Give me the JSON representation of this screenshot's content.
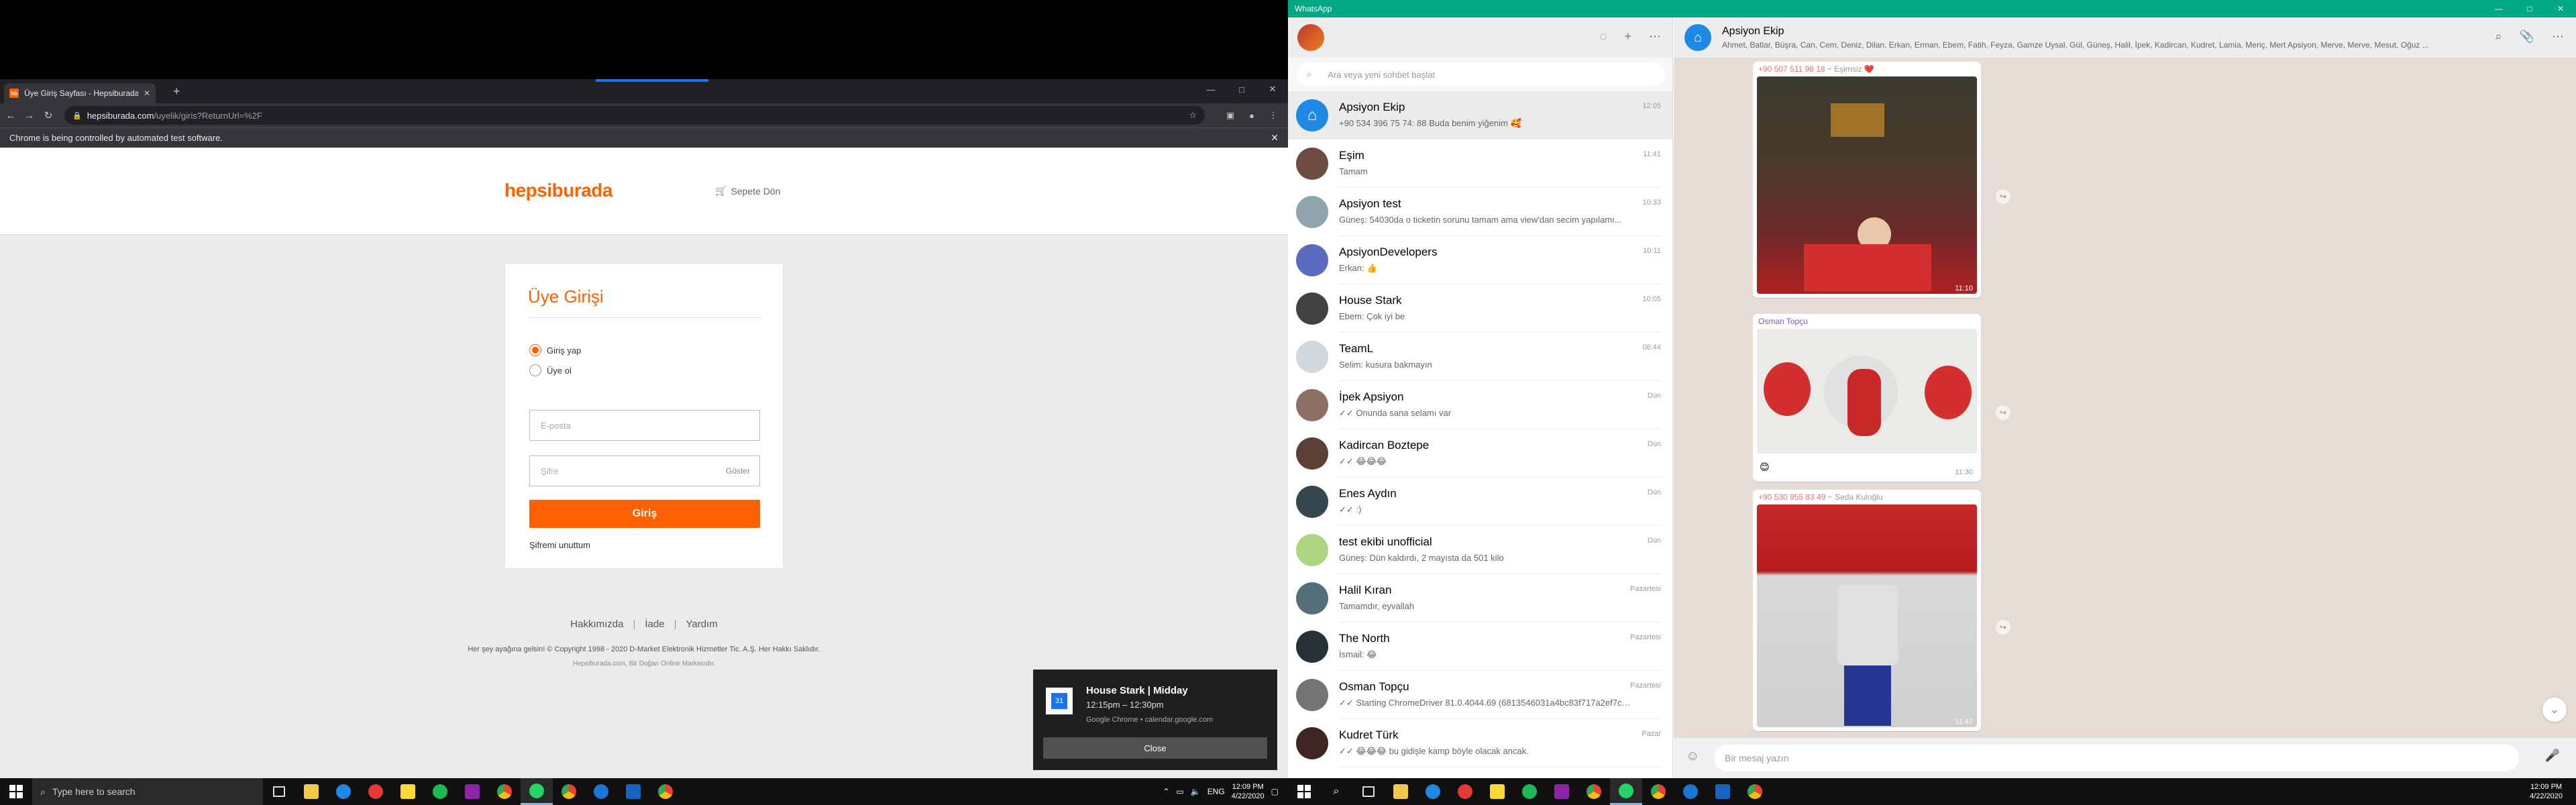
{
  "browser": {
    "tab_title": "Üye Giriş Sayfası - Hepsiburada...",
    "tab_favicon_text": "hb",
    "url_host": "hepsiburada.com",
    "url_path": "/uyelik/giris?ReturnUrl=%2F",
    "infobar_text": "Chrome is being controlled by automated test software.",
    "window_controls": [
      "—",
      "□",
      "✕"
    ]
  },
  "site": {
    "logo": "hepsiburada",
    "cart_link": "Sepete Dön",
    "login_title": "Üye Girişi",
    "radio_login": "Giriş yap",
    "radio_register": "Üye ol",
    "email_placeholder": "E-posta",
    "password_placeholder": "Şifre",
    "show_label": "Göster",
    "submit_label": "Giriş",
    "forgot_label": "Şifremi unuttum",
    "footer_links": [
      "Hakkımızda",
      "İade",
      "Yardım"
    ],
    "footer_sep": "|",
    "copyright": "Her şey ayağına gelsin! © Copyright 1998 - 2020 D-Market Elektronik Hizmetler Tic. A.Ş. Her Hakkı Saklıdır.",
    "copyright_sub": "Hepsiburada.com, Bir Doğan Online Markasıdır."
  },
  "toast": {
    "title": "House Stark | Midday",
    "time": "12:15pm – 12:30pm",
    "source": "Google Chrome • calendar.google.com",
    "close_label": "Close",
    "icon_text": "31"
  },
  "taskbar_left": {
    "search_placeholder": "Type here to search",
    "time": "12:09 PM",
    "date": "4/22/2020"
  },
  "taskbar_right": {
    "time": "12:09 PM",
    "date": "4/22/2020"
  },
  "whatsapp": {
    "app_title": "WhatsApp",
    "search_placeholder": "Ara veya yeni sohbet başlat",
    "chats": [
      {
        "name": "Apsiyon Ekip",
        "time": "12:05",
        "last": "+90 534 396 75 74: 88 Buda benim yiğenim 🥰"
      },
      {
        "name": "Eşim",
        "time": "11:41",
        "last": "Tamam"
      },
      {
        "name": "Apsiyon test",
        "time": "10:33",
        "last": "Güneş: 54030da o ticketin sorunu tamam ama view'dan secim yapılamı..."
      },
      {
        "name": "ApsiyonDevelopers",
        "time": "10:11",
        "last": "Erkan: 👍"
      },
      {
        "name": "House Stark",
        "time": "10:05",
        "last": "Ebem: Çok iyi be"
      },
      {
        "name": "TeamL",
        "time": "08:44",
        "last": "Selim: kusura bakmayın"
      },
      {
        "name": "İpek Apsiyon",
        "time": "Dün",
        "last": "✓✓ Onunda sana selamı var"
      },
      {
        "name": "Kadircan Boztepe",
        "time": "Dün",
        "last": "✓✓ 😂😂😂"
      },
      {
        "name": "Enes Aydın",
        "time": "Dün",
        "last": "✓✓ :)"
      },
      {
        "name": "test ekibi unofficial",
        "time": "Dün",
        "last": "Güneş: Dün kaldırdı, 2 mayısta da 501 kilo"
      },
      {
        "name": "Halil Kıran",
        "time": "Pazartesi",
        "last": "Tamamdır, eyvallah"
      },
      {
        "name": "The North",
        "time": "Pazartesi",
        "last": "İsmail: 😂"
      },
      {
        "name": "Osman Topçu",
        "time": "Pazartesi",
        "last": "✓✓ Starting ChromeDriver 81.0.4044.69 (6813546031a4bc83f717a2ef7cd4a..."
      },
      {
        "name": "Kudret Türk",
        "time": "Pazar",
        "last": "✓✓ 😂😂😂 bu gidişle kamp böyle olacak ancak."
      }
    ],
    "conversation": {
      "title": "Apsiyon Ekip",
      "members": "Ahmet, Batlar, Büşra, Can, Cem, Deniz, Dilan, Erkan, Erman, Ebem, Fatih, Feyza, Gamze Uysal, Gül, Güneş, Halil, İpek, Kadircan, Kudret, Lamia, Meriç, Mert Apsiyon, Merve, Merve, Mesut, Oğuz ...",
      "messages": [
        {
          "sender": "+90 507 511 98 18",
          "sender_name": "~ Eşimsiz ❤️",
          "time": "11:10"
        },
        {
          "sender": "Osman Topçu",
          "time": "11:30",
          "caption": "😊"
        },
        {
          "sender": "+90 530 955 83 49",
          "sender_name": "~ Seda Kuloğlu",
          "time": "11:47"
        }
      ],
      "composer_placeholder": "Bir mesaj yazın"
    }
  },
  "colors": {
    "brand": "#ff6000",
    "whatsapp": "#00a884"
  }
}
